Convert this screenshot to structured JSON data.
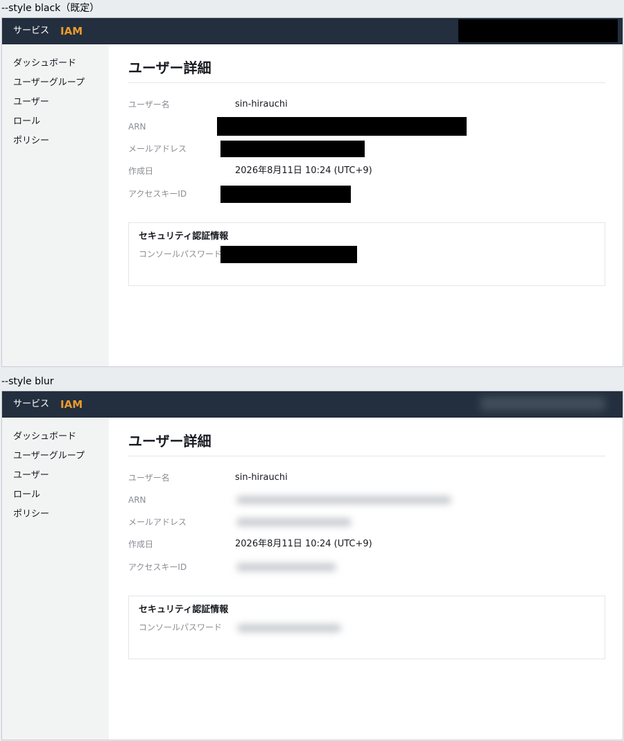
{
  "sections": [
    {
      "caption": "--style black（既定）",
      "style": "black"
    },
    {
      "caption": "--style blur",
      "style": "blur"
    }
  ],
  "header": {
    "services_label": "サービス",
    "brand": "IAM"
  },
  "sidebar": {
    "items": [
      {
        "label": "ダッシュボード"
      },
      {
        "label": "ユーザーグループ"
      },
      {
        "label": "ユーザー"
      },
      {
        "label": "ロール"
      },
      {
        "label": "ポリシー"
      }
    ]
  },
  "detail": {
    "title": "ユーザー詳細",
    "fields": {
      "username_label": "ユーザー名",
      "username_value": "sin-hirauchi",
      "arn_label": "ARN",
      "email_label": "メールアドレス",
      "created_label": "作成日",
      "created_value": "2026年8月11日 10:24 (UTC+9)",
      "access_key_label": "アクセスキーID"
    },
    "credentials": {
      "heading": "セキュリティ認証情報",
      "password_label": "コンソールパスワード"
    }
  },
  "colors": {
    "header_bg": "#232f3e",
    "brand": "#ec9b2c",
    "sidebar_bg": "#f2f3f3"
  }
}
